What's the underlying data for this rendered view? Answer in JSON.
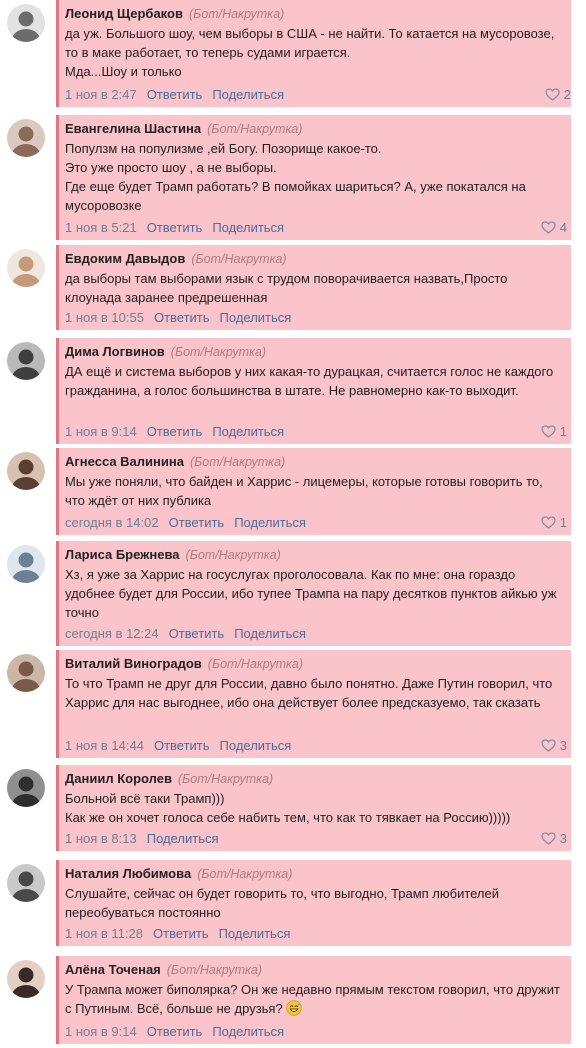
{
  "tag_label": "(Бот/Накрутка)",
  "reply_label": "Ответить",
  "share_label": "Поделиться",
  "colors": {
    "card_bg": "#fac4ca",
    "card_border": "#e0777f",
    "tag": "#b07a84",
    "link": "#4a6d9d",
    "meta": "#6d7f99"
  },
  "comments": [
    {
      "author": "Леонид Щербаков",
      "text": "да уж. Большого шоу, чем выборы в США - не найти. То катается на мусоровозе, то в маке работает, то теперь судами играется.\nМда...Шоу и только",
      "time": "1 ноя в 2:47",
      "likes": "2",
      "avatar_icon": "avatar-photo-icon"
    },
    {
      "author": "Евангелина Шастина",
      "text": "Популзм на популизме ,ей Богу. Позорище какое-то.\nЭто уже просто шоу , а не выборы.\nГде еще будет Трамп работать? В помойках шариться? А, уже покатался на мусоровозке",
      "time": "1 ноя в 5:21",
      "likes": "4",
      "avatar_icon": "avatar-photo-icon"
    },
    {
      "author": "Евдоким Давыдов",
      "text": "да выборы там выборами язык с трудом поворачивается назвать,Просто клоунада заранее предрешенная",
      "time": "1 ноя в 10:55",
      "likes": "",
      "avatar_icon": "avatar-photo-icon"
    },
    {
      "author": "Дима Логвинов",
      "text": "ДА ещё и система выборов у них какая-то дурацкая, считается голос не каждого гражданина, а голос большинства в штате. Не равномерно как-то выходит.",
      "time": "1 ноя в 9:14",
      "likes": "1",
      "avatar_icon": "avatar-photo-icon"
    },
    {
      "author": "Агнесса Валинина",
      "text": "Мы уже поняли, что байден и Харрис - лицемеры, которые готовы говорить то, что ждёт от них публика",
      "time": "сегодня в 14:02",
      "likes": "1",
      "avatar_icon": "avatar-photo-icon"
    },
    {
      "author": "Лариса Брежнева",
      "text": "Хз, я уже за Харрис на госуслугах проголосовала. Как по мне: она гораздо удобнее будет для России, ибо тупее Трампа на пару десятков пунктов айкью уж точно",
      "time": "сегодня в 12:24",
      "likes": "",
      "avatar_icon": "avatar-photo-icon"
    },
    {
      "author": "Виталий Виноградов",
      "text": "То что Трамп не друг для России, давно было понятно. Даже Путин говорил, что Харрис для нас выгоднее, ибо она действует более предсказуемо, так сказать",
      "time": "1 ноя в 14:44",
      "likes": "3",
      "avatar_icon": "avatar-photo-icon"
    },
    {
      "author": "Даниил Королев",
      "text": "Больной всё таки Трамп)))\nКак же он хочет голоса себе набить тем, что как то тявкает на Россию)))))",
      "time": "1 ноя в 8:13",
      "likes": "3",
      "no_reply": true,
      "avatar_icon": "avatar-photo-icon"
    },
    {
      "author": "Наталия Любимова",
      "text": "Слушайте, сейчас он будет говорить то, что выгодно, Трамп любителей переобуваться постоянно",
      "time": "1 ноя в 11:28",
      "likes": "",
      "avatar_icon": "avatar-photo-icon"
    },
    {
      "author": "Алёна Точеная",
      "text": "У Трампа может биполярка? Он же недавно прямым текстом говорил, что дружит с Путиным. Всё, больше не друзья?",
      "time": "1 ноя в 9:14",
      "likes": "",
      "emoji_icon": "grinning-sweat-emoji-icon",
      "avatar_icon": "avatar-photo-icon"
    }
  ]
}
